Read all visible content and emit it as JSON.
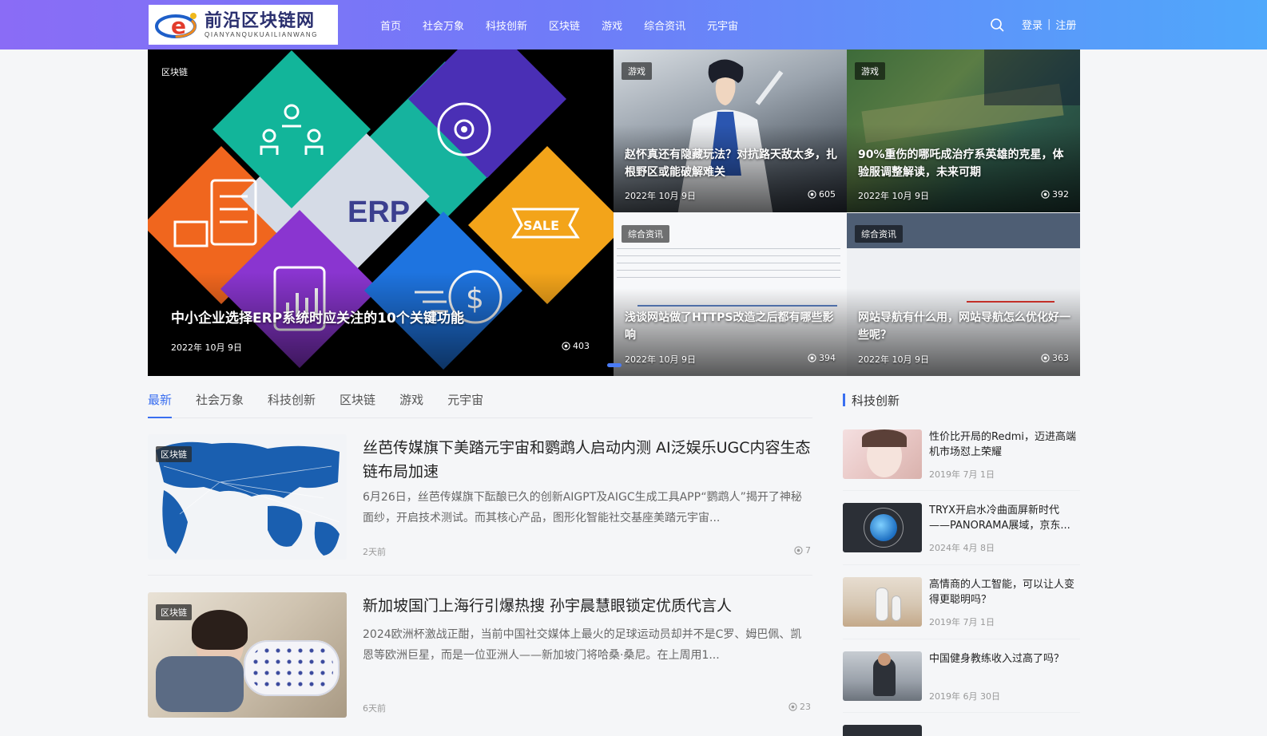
{
  "header": {
    "logo_title": "前沿区块链网",
    "logo_sub": "QIANYANQUKUAILIANWANG",
    "nav": [
      "首页",
      "社会万象",
      "科技创新",
      "区块链",
      "游戏",
      "综合资讯",
      "元宇宙"
    ],
    "login": "登录",
    "separator": "|",
    "register": "注册"
  },
  "hero": {
    "main": {
      "tag": "区块链",
      "erp_label": "ERP",
      "sale_label": "SALE",
      "title": "中小企业选择ERP系统时应关注的10个关键功能",
      "date": "2022年 10月 9日",
      "views": "403"
    },
    "cells": [
      {
        "tag": "游戏",
        "title": "赵怀真还有隐藏玩法？对抗路天敌太多，扎根野区或能破解难关",
        "date": "2022年 10月 9日",
        "views": "605"
      },
      {
        "tag": "游戏",
        "title": "90%重伤的哪吒成治疗系英雄的克星，体验服调整解读，未来可期",
        "date": "2022年 10月 9日",
        "views": "392"
      },
      {
        "tag": "综合资讯",
        "title": "浅谈网站做了HTTPS改造之后都有哪些影响",
        "date": "2022年 10月 9日",
        "views": "394"
      },
      {
        "tag": "综合资讯",
        "title": "网站导航有什么用，网站导航怎么优化好一些呢？",
        "date": "2022年 10月 9日",
        "views": "363"
      }
    ]
  },
  "tabs": [
    "最新",
    "社会万象",
    "科技创新",
    "区块链",
    "游戏",
    "元宇宙"
  ],
  "posts": [
    {
      "tag": "区块链",
      "title": "丝芭传媒旗下美踏元宇宙和鹦鹉人启动内测 AI泛娱乐UGC内容生态链布局加速",
      "excerpt": "6月26日，丝芭传媒旗下酝酿已久的创新AIGPT及AIGC生成工具APP“鹦鹉人”揭开了神秘面纱，开启技术测试。而其核心产品，图形化智能社交基座美踏元宇宙...",
      "time": "2天前",
      "views": "7"
    },
    {
      "tag": "区块链",
      "title": "新加坡国门上海行引爆热搜 孙宇晨慧眼锁定优质代言人",
      "excerpt": "2024欧洲杯激战正酣，当前中国社交媒体上最火的足球运动员却并不是C罗、姆巴佩、凯恩等欧洲巨星，而是一位亚洲人——新加坡门将哈桑·桑尼。在上周用1...",
      "time": "6天前",
      "views": "23"
    }
  ],
  "sidebar": {
    "title": "科技创新",
    "items": [
      {
        "title": "性价比开局的Redmi，迈进高端机市场怼上荣耀",
        "date": "2019年 7月 1日"
      },
      {
        "title": "TRYX开启水冷曲面屏新时代——PANORAMA展域，京东...",
        "date": "2024年 4月 8日"
      },
      {
        "title": "高情商的人工智能，可以让人变得更聪明吗？",
        "date": "2019年 7月 1日"
      },
      {
        "title": "中国健身教练收入过高了吗？",
        "date": "2019年 6月 30日"
      }
    ]
  },
  "colors": {
    "accent": "#3a6ff0",
    "header_start": "#8a6cf6",
    "header_end": "#4fa8fb"
  }
}
